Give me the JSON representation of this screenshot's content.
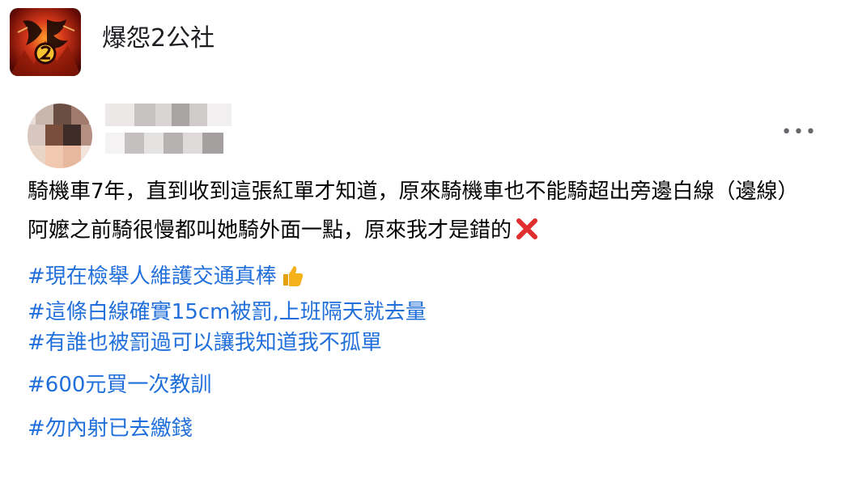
{
  "group": {
    "name": "爆怨2公社",
    "logo_icon": "group-logo-icon"
  },
  "post": {
    "more_label": "•••",
    "paragraphs": [
      "騎機車7年，直到收到這張紅單才知道，原來騎機車也不能騎超出旁邊白線（邊線）",
      "阿嬤之前騎很慢都叫她騎外面一點，原來我才是錯的"
    ],
    "hashtags": [
      "#現在檢舉人維護交通真棒",
      "#這條白線確實15cm被罰,上班隔天就去量",
      "#有誰也被罰過可以讓我知道我不孤單",
      "#600元買一次教訓",
      "#勿內射已去繳錢"
    ],
    "emojis": {
      "cross": "cross-mark-icon",
      "thumbs_up": "thumbs-up-icon"
    }
  },
  "colors": {
    "hashtag": "#216fdb",
    "text": "#050505",
    "more": "#65676b",
    "cross": "#e02d2d",
    "thumb": "#f5b21c"
  }
}
